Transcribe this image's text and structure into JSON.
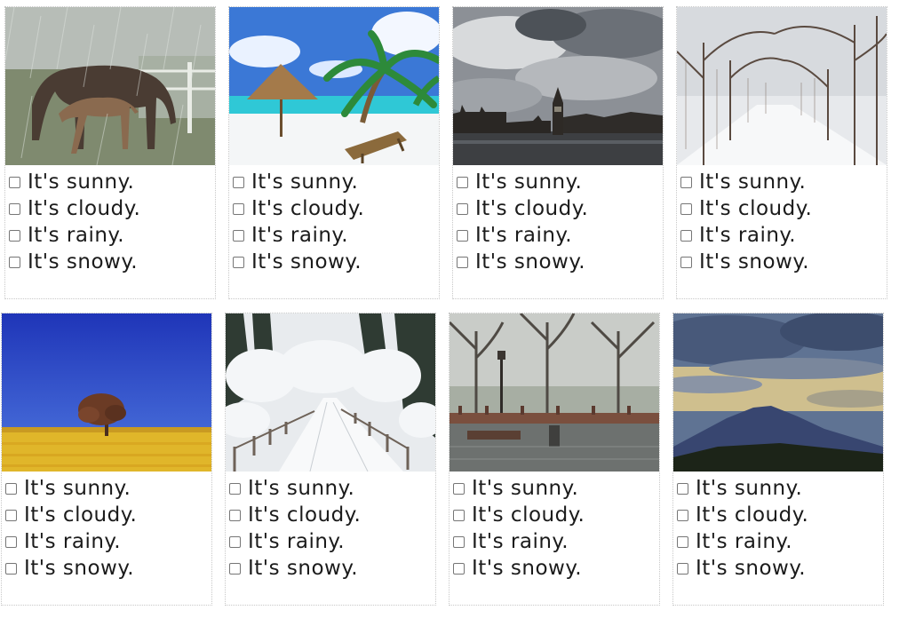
{
  "cards": [
    {
      "scene": "horse-in-rain",
      "options": [
        "It's sunny.",
        "It's cloudy.",
        "It's rainy.",
        "It's snowy."
      ]
    },
    {
      "scene": "tropical-beach",
      "options": [
        "It's sunny.",
        "It's cloudy.",
        "It's rainy.",
        "It's snowy."
      ]
    },
    {
      "scene": "cloudy-city",
      "options": [
        "It's sunny.",
        "It's cloudy.",
        "It's rainy.",
        "It's snowy."
      ]
    },
    {
      "scene": "snowy-forest-path",
      "options": [
        "It's sunny.",
        "It's cloudy.",
        "It's rainy.",
        "It's snowy."
      ]
    },
    {
      "scene": "tree-in-yellow-field",
      "options": [
        "It's sunny.",
        "It's cloudy.",
        "It's rainy.",
        "It's snowy."
      ]
    },
    {
      "scene": "snowy-road",
      "options": [
        "It's sunny.",
        "It's cloudy.",
        "It's rainy.",
        "It's snowy."
      ]
    },
    {
      "scene": "rainy-waterfront",
      "options": [
        "It's sunny.",
        "It's cloudy.",
        "It's rainy.",
        "It's snowy."
      ]
    },
    {
      "scene": "mountain-under-clouds",
      "options": [
        "It's sunny.",
        "It's cloudy.",
        "It's rainy.",
        "It's snowy."
      ]
    }
  ]
}
